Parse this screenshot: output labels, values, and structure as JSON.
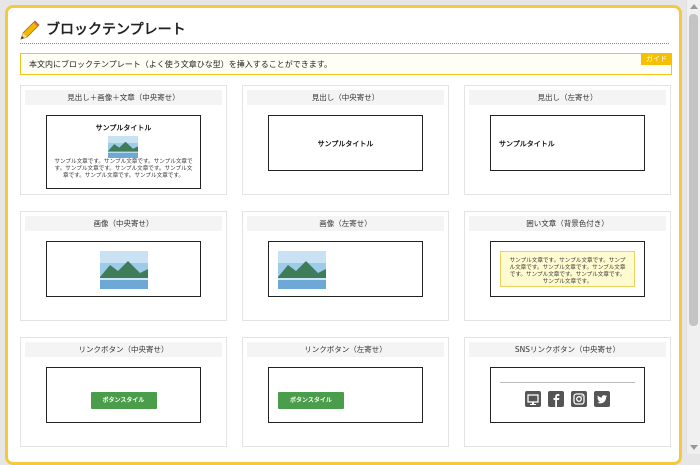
{
  "page": {
    "title": "ブロックテンプレート",
    "notice": "本文内にブロックテンプレート（よく使う文章ひな型）を挿入することができます。",
    "guide_label": "ガイド"
  },
  "sample": {
    "title": "サンプルタイトル",
    "text": "サンプル文章です。サンプル文章です。サンプル文章です。サンプル文章です。サンプル文章です。サンプル文章です。サンプル文章です。サンプル文章です。",
    "button": "ボタンスタイル"
  },
  "templates": [
    {
      "label": "見出し＋画像＋文章（中央寄せ）"
    },
    {
      "label": "見出し（中央寄せ）"
    },
    {
      "label": "見出し（左寄せ）"
    },
    {
      "label": "画像（中央寄せ）"
    },
    {
      "label": "画像（左寄せ）"
    },
    {
      "label": "囲い文章（背景色付き）"
    },
    {
      "label": "リンクボタン（中央寄せ）"
    },
    {
      "label": "リンクボタン（左寄せ）"
    },
    {
      "label": "SNSリンクボタン（中央寄せ）"
    }
  ],
  "sns_icons": [
    "monitor-icon",
    "facebook-icon",
    "instagram-icon",
    "twitter-icon"
  ],
  "colors": {
    "frame": "#f5c842",
    "guide": "#f5c000",
    "button": "#4a9d4a",
    "boxed_bg": "#fffbd0",
    "sns_icon": "#555555"
  }
}
